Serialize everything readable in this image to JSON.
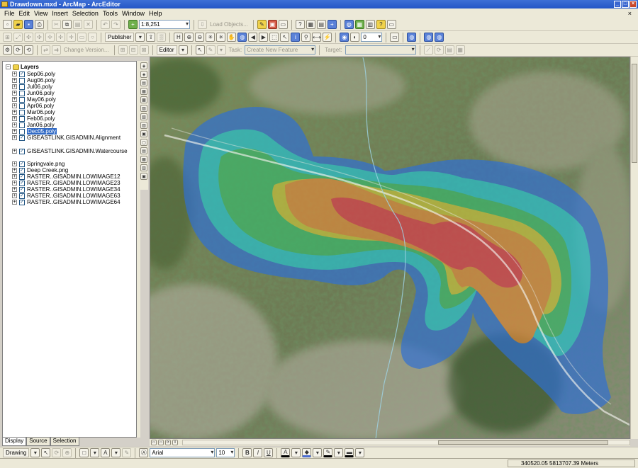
{
  "window": {
    "title": "Drawdown.mxd - ArcMap - ArcEditor"
  },
  "menu": [
    "File",
    "Edit",
    "View",
    "Insert",
    "Selection",
    "Tools",
    "Window",
    "Help"
  ],
  "toolbar_standard": {
    "scale": "1:8,251",
    "load_objects": "Load Objects..."
  },
  "toolbar_tools": {
    "publisher": "Publisher",
    "raster_value": "0"
  },
  "toolbar_editor": {
    "change_version": "Change Version...",
    "editor": "Editor",
    "task_label": "Task:",
    "task_value": "Create New Feature",
    "target_label": "Target:"
  },
  "toc": {
    "root": "Layers",
    "layers": [
      {
        "name": "Sep06.poly",
        "checked": true
      },
      {
        "name": "Aug06.poly",
        "checked": false
      },
      {
        "name": "Jul06.poly",
        "checked": false
      },
      {
        "name": "Jun06.poly",
        "checked": false
      },
      {
        "name": "May06.poly",
        "checked": false
      },
      {
        "name": "Apr06.poly",
        "checked": false
      },
      {
        "name": "Mar06.poly",
        "checked": false
      },
      {
        "name": "Feb06.poly",
        "checked": false
      },
      {
        "name": "Jan06.poly",
        "checked": false
      },
      {
        "name": "Dec05.poly",
        "checked": false,
        "selected": true
      },
      {
        "name": "GISEASTLINK.GISADMIN.Alignment",
        "checked": true
      },
      {
        "name": "GISEASTLINK.GISADMIN.Watercourse",
        "checked": true
      },
      {
        "name": "Springvale.png",
        "checked": true
      },
      {
        "name": "Deep Creek.png",
        "checked": true
      },
      {
        "name": "RASTER..GISADMIN.LOWIMAGE12",
        "checked": true
      },
      {
        "name": "RASTER..GISADMIN.LOWIMAGE23",
        "checked": true
      },
      {
        "name": "RASTER..GISADMIN.LOWIMAGE34",
        "checked": true
      },
      {
        "name": "RASTER..GISADMIN.LOWIMAGE63",
        "checked": true
      },
      {
        "name": "RASTER..GISADMIN.LOWIMAGE64",
        "checked": true
      }
    ],
    "tabs": [
      "Display",
      "Source",
      "Selection"
    ]
  },
  "drawing_toolbar": {
    "drawing": "Drawing",
    "font": "Arial",
    "size": "10"
  },
  "status": {
    "coordinates": "340520.05  5813707.39 Meters"
  },
  "colors": {
    "title_bar": "#2456c6",
    "chrome": "#ece9d8",
    "selection": "#316ac5",
    "drawdown_blue": "#2f6fd6",
    "drawdown_cyan": "#24c3d2",
    "drawdown_green": "#39b86b",
    "drawdown_yellow": "#c8c23a",
    "drawdown_orange": "#e08a3a",
    "drawdown_red": "#e03a4a"
  },
  "icons": [
    "new-icon",
    "open-icon",
    "save-icon",
    "print-icon",
    "cut-icon",
    "copy-icon",
    "paste-icon",
    "delete-icon",
    "undo-icon",
    "redo-icon",
    "add-data-icon",
    "zoom-in-icon",
    "zoom-out-icon",
    "pan-icon",
    "full-extent-icon",
    "identify-icon",
    "find-icon",
    "measure-icon",
    "hyperlink-icon",
    "edit-tool-icon",
    "sketch-tool-icon",
    "arrow-select-icon",
    "text-icon",
    "bold-icon",
    "italic-icon",
    "underline-icon",
    "fill-color-icon",
    "line-color-icon",
    "font-color-icon"
  ]
}
